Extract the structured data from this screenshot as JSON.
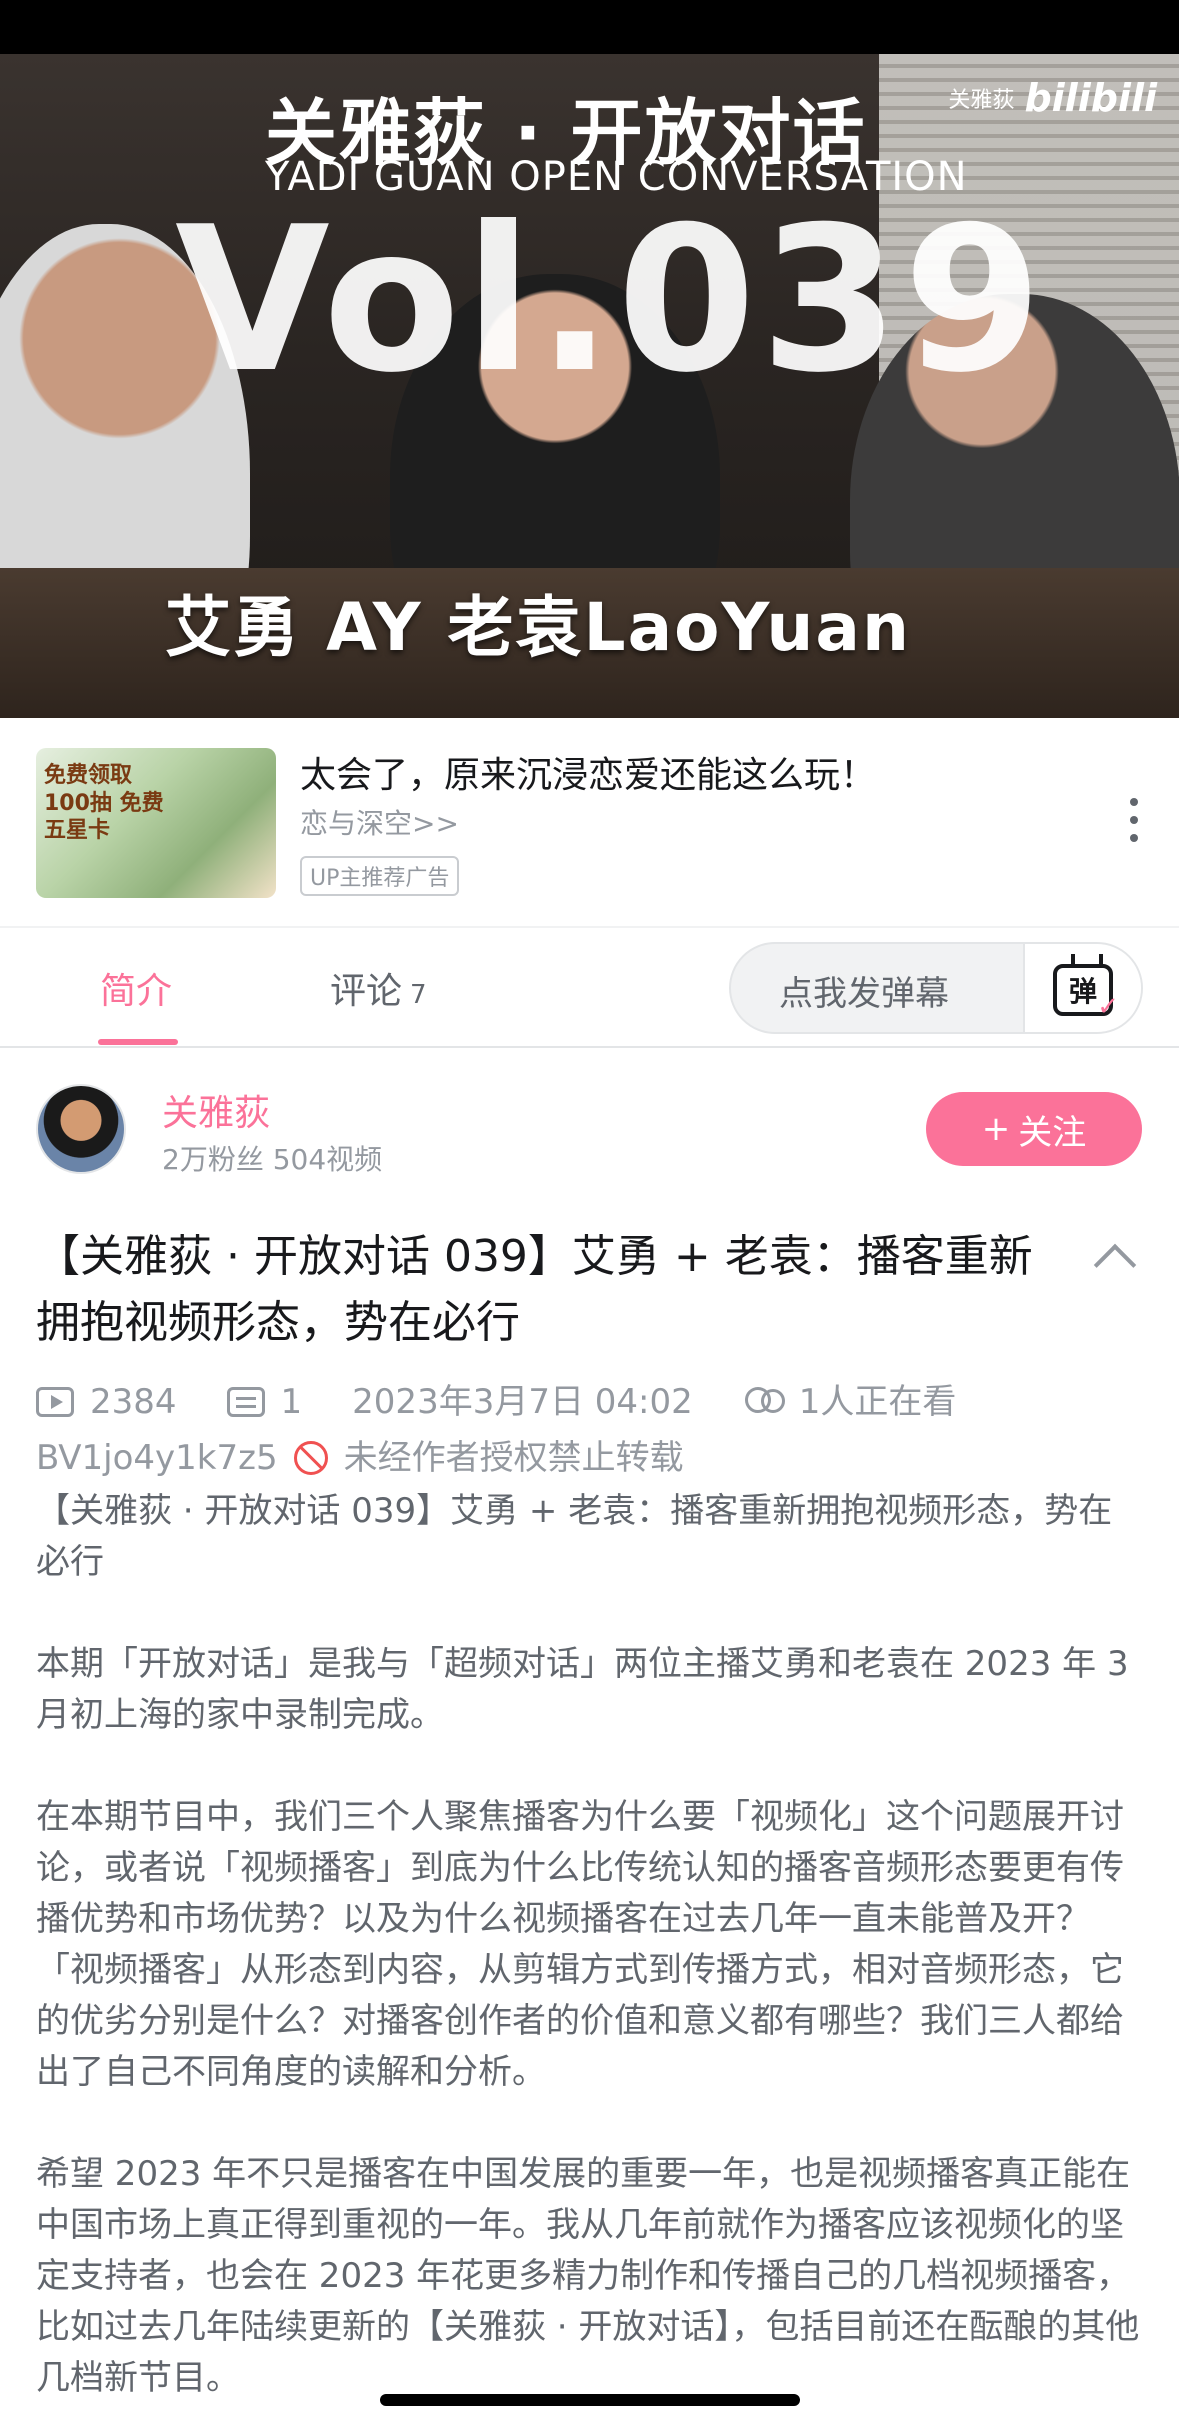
{
  "cover": {
    "brand_cn": "关雅荻 · 开放对话",
    "brand_en": "YADI GUAN OPEN CONVERSATION",
    "volume": "Vol.039",
    "guests": "艾勇 AY  老袁LaoYuan",
    "watermark_name": "关雅荻",
    "watermark_logo": "bilibili"
  },
  "ad": {
    "thumb_text": "免费领取100抽 免费五星卡",
    "title": "太会了，原来沉浸恋爱还能这么玩！",
    "subtitle": "恋与深空>>",
    "tag": "UP主推荐广告"
  },
  "tabs": {
    "intro": "简介",
    "comments": "评论",
    "comments_count": "7",
    "danmaku_placeholder": "点我发弹幕",
    "danmaku_icon_char": "弹"
  },
  "uploader": {
    "name": "关雅荻",
    "stats": "2万粉丝  504视频",
    "follow_label": "关注",
    "follow_plus": "+"
  },
  "video": {
    "title": "【关雅荻 · 开放对话 039】艾勇 + 老袁：播客重新拥抱视频形态，势在必行",
    "views": "2384",
    "danmaku_count": "1",
    "date": "2023年3月7日 04:02",
    "watching": "1人正在看",
    "bvid": "BV1jo4y1k7z5",
    "copyright": "未经作者授权禁止转载"
  },
  "description": [
    "【关雅荻 · 开放对话 039】艾勇 + 老袁：播客重新拥抱视频形态，势在必行",
    "本期「开放对话」是我与「超频对话」两位主播艾勇和老袁在 2023 年 3 月初上海的家中录制完成。",
    "在本期节目中，我们三个人聚焦播客为什么要「视频化」这个问题展开讨论，或者说「视频播客」到底为什么比传统认知的播客音频形态要更有传播优势和市场优势？以及为什么视频播客在过去几年一直未能普及开？「视频播客」从形态到内容，从剪辑方式到传播方式，相对音频形态，它的优劣分别是什么？对播客创作者的价值和意义都有哪些？我们三人都给出了自己不同角度的读解和分析。",
    "希望 2023 年不只是播客在中国发展的重要一年，也是视频播客真正能在中国市场上真正得到重视的一年。我从几年前就作为播客应该视频化的坚定支持者，也会在 2023 年花更多精力制作和传播自己的几档视频播客，比如过去几年陆续更新的【关雅荻 · 开放对话】，包括目前还在酝酿的其他几档新节目。"
  ],
  "colors": {
    "accent": "#fb7299",
    "text_primary": "#18191c",
    "text_secondary": "#61666d",
    "text_muted": "#9499a0",
    "warning": "#f05151"
  }
}
